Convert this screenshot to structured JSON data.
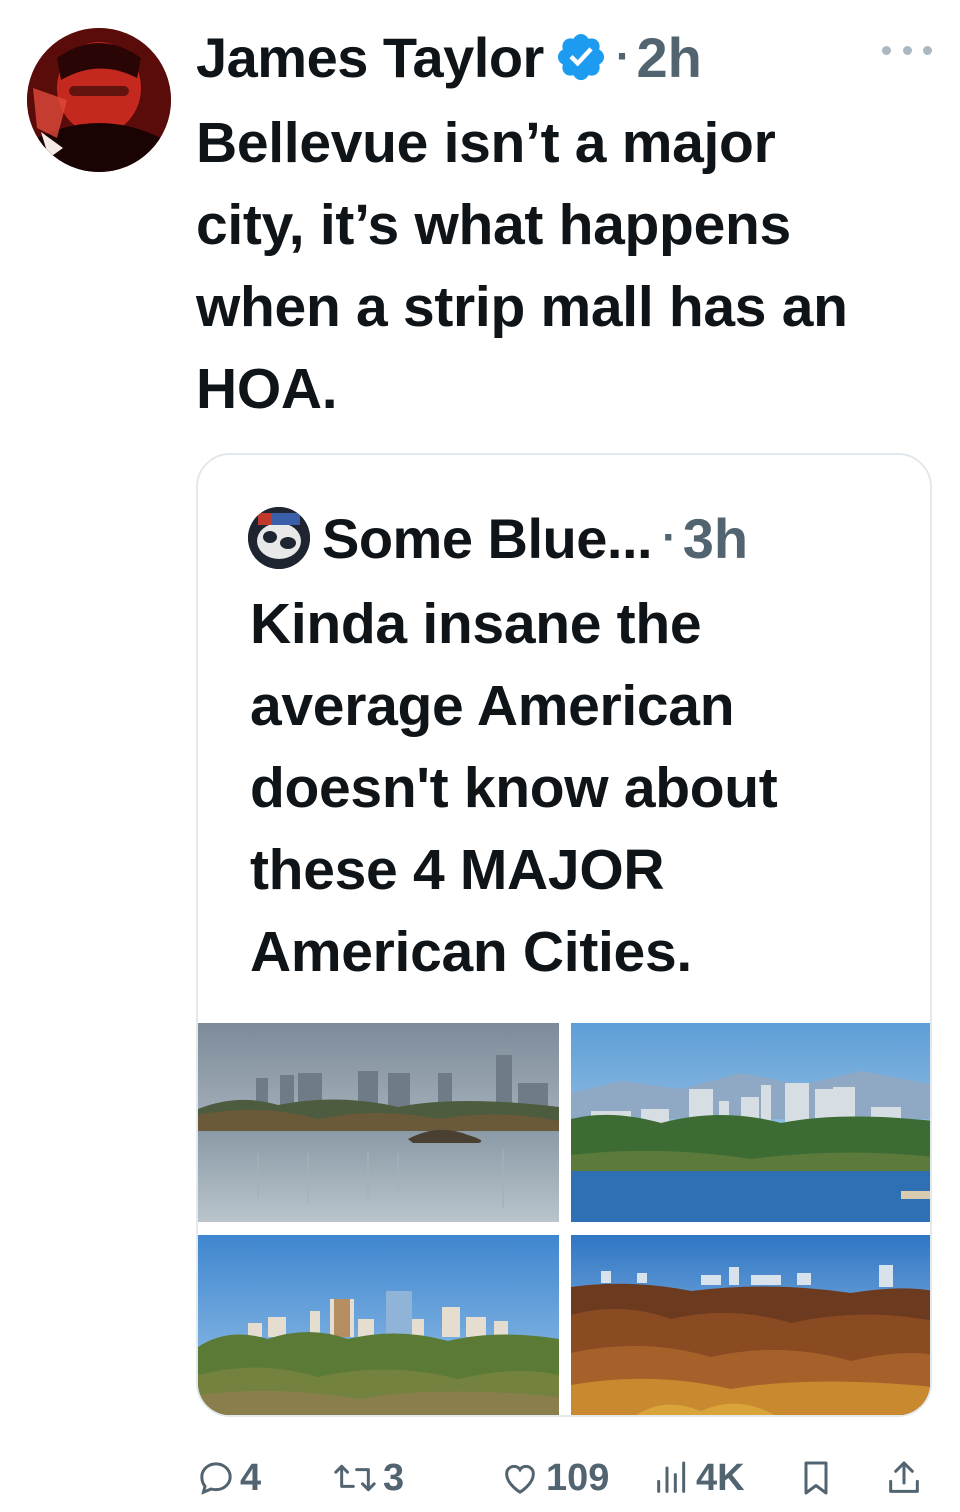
{
  "tweet": {
    "author_name": "James Taylor",
    "verified": true,
    "separator": "·",
    "time": "2h",
    "text": "Bellevue isn’t a major\ncity, it’s what happens\nwhen a strip mall has an\nHOA."
  },
  "quoted_tweet": {
    "author_name": "Some Blue...",
    "separator": "·",
    "time": "3h",
    "text": "Kinda insane the\naverage American\ndoesn't know about\nthese 4 MAJOR\nAmerican Cities.",
    "media_count": 4
  },
  "actions": {
    "replies": "4",
    "reposts": "3",
    "likes": "109",
    "views": "4K"
  },
  "colors": {
    "text": "#0f1419",
    "secondary": "#536471",
    "verified_blue": "#1d9bf0",
    "border": "#e3e8ec"
  },
  "icons": [
    "avatar",
    "verified-badge-icon",
    "more-icon",
    "reply-icon",
    "repost-icon",
    "like-icon",
    "views-icon",
    "bookmark-icon",
    "share-icon"
  ]
}
